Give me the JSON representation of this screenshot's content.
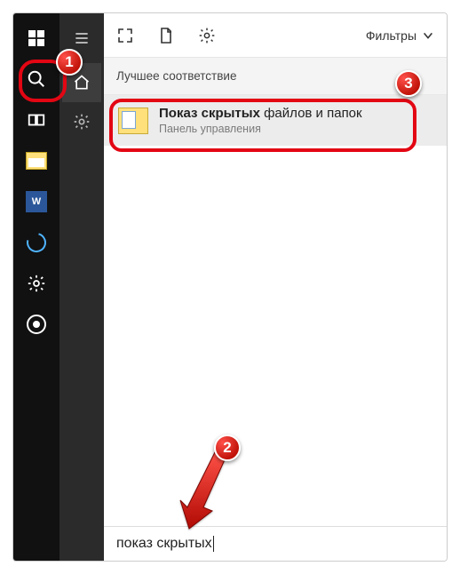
{
  "taskbar": {
    "icons": {
      "start": "start-icon",
      "search": "search-icon",
      "taskview": "taskview-icon",
      "explorer": "explorer-icon",
      "word": "word-icon",
      "word_letter": "W",
      "update": "update-icon",
      "settings": "gear-icon",
      "record": "record-icon"
    }
  },
  "search_rail": {
    "icons": {
      "menu": "hamburger-icon",
      "home": "home-icon",
      "settings": "gear-icon"
    }
  },
  "panel": {
    "top_icons": {
      "expand": "expand-icon",
      "document": "document-icon",
      "settings": "gear-icon"
    },
    "filters_label": "Фильтры",
    "section_label": "Лучшее соответствие",
    "result": {
      "title_bold": "Показ скрытых",
      "title_rest": " файлов и папок",
      "subtitle": "Панель управления"
    },
    "search_text": "показ скрытых"
  },
  "annotations": {
    "badge1": "1",
    "badge2": "2",
    "badge3": "3"
  }
}
